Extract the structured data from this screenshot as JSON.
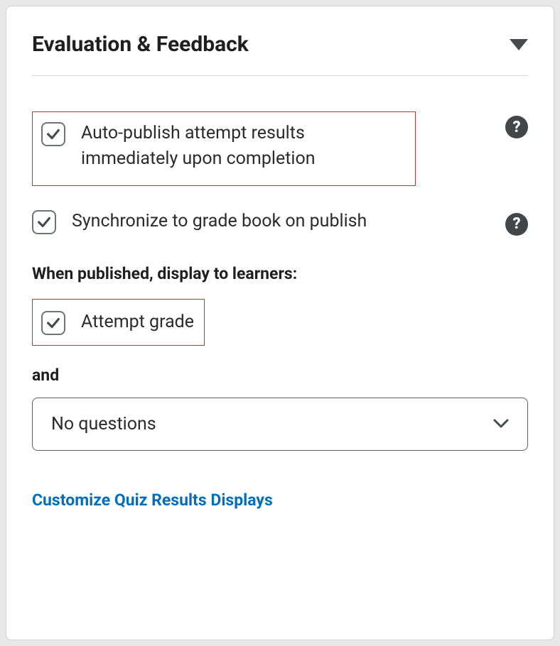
{
  "panel": {
    "title": "Evaluation & Feedback"
  },
  "options": {
    "auto_publish": {
      "label": "Auto-publish attempt results immediately upon completion",
      "checked": true
    },
    "sync_gradebook": {
      "label": "Synchronize to grade book on publish",
      "checked": true
    }
  },
  "display_section": {
    "heading": "When published, display to learners:",
    "attempt_grade": {
      "label": "Attempt grade",
      "checked": true
    },
    "and_label": "and",
    "dropdown": {
      "value": "No questions"
    }
  },
  "customize_link": "Customize Quiz Results Displays"
}
